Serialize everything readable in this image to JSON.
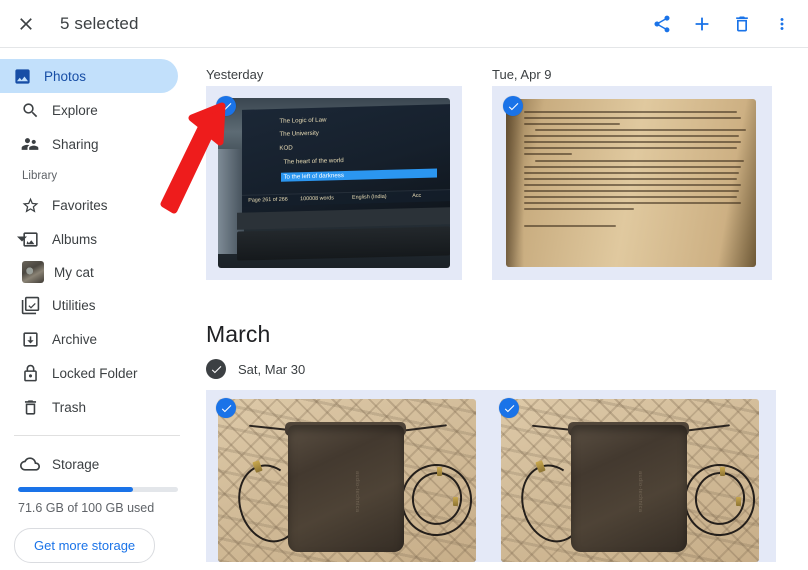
{
  "appbar": {
    "close_icon": "close-icon",
    "title": "5 selected",
    "actions": [
      {
        "name": "share-button",
        "icon": "share-icon"
      },
      {
        "name": "add-to-button",
        "icon": "plus-icon"
      },
      {
        "name": "delete-button",
        "icon": "trash-icon"
      },
      {
        "name": "more-options-button",
        "icon": "more-vert-icon"
      }
    ]
  },
  "sidebar": {
    "items": [
      {
        "label": "Photos",
        "icon": "photo-icon",
        "selected": true
      },
      {
        "label": "Explore",
        "icon": "search-icon",
        "selected": false
      },
      {
        "label": "Sharing",
        "icon": "people-icon",
        "selected": false
      }
    ],
    "library_label": "Library",
    "library_items": [
      {
        "label": "Favorites",
        "icon": "star-icon"
      },
      {
        "label": "Albums",
        "icon": "albums-icon",
        "expanded": true
      },
      {
        "label": "My cat",
        "icon": "album-thumbnail",
        "sub": true
      },
      {
        "label": "Utilities",
        "icon": "utilities-icon"
      },
      {
        "label": "Archive",
        "icon": "archive-icon"
      },
      {
        "label": "Locked Folder",
        "icon": "lock-icon"
      },
      {
        "label": "Trash",
        "icon": "trash-icon"
      }
    ],
    "storage": {
      "label": "Storage",
      "icon": "cloud-icon",
      "used_text": "71.6 GB of 100 GB used",
      "percent": 71.6,
      "button_label": "Get more storage",
      "bar_color": "#1a73e8",
      "bar_track_color": "#e3e6ea"
    }
  },
  "content": {
    "sections": [
      {
        "month_heading": "",
        "groups": [
          {
            "date_label": "Yesterday",
            "date_has_check": false,
            "photos": [
              {
                "name": "photo-monitor-document-list",
                "selected": true,
                "screen_lines": [
                  "The Logic of Law",
                  "The University",
                  "KOD",
                  "The heart of the world"
                ],
                "screen_highlighted_line": "To the left of darkness",
                "status_bar": {
                  "page": "Page 261 of 266",
                  "words": "100008 words",
                  "language": "English (India)",
                  "accessibility": "Acc"
                }
              }
            ]
          },
          {
            "date_label": "Tue, Apr 9",
            "date_has_check": false,
            "photos": [
              {
                "name": "photo-open-book-page",
                "selected": true
              }
            ]
          }
        ]
      },
      {
        "month_heading": "March",
        "groups": [
          {
            "date_label": "Sat, Mar 30",
            "date_has_check": true,
            "photos": [
              {
                "name": "photo-pouch-with-cables-1",
                "selected": true
              },
              {
                "name": "photo-pouch-with-cables-2",
                "selected": true
              }
            ]
          }
        ]
      }
    ]
  },
  "annotation": {
    "arrow_color": "#ee1c1c",
    "points_at": "selection-checkmark-of-first-photo"
  },
  "colors": {
    "accent_blue": "#1a73e8",
    "selected_nav_bg": "#c2e0fb",
    "selected_cell_bg": "#e4e9f7",
    "text_primary": "#3c4043",
    "text_secondary": "#5f6368"
  }
}
